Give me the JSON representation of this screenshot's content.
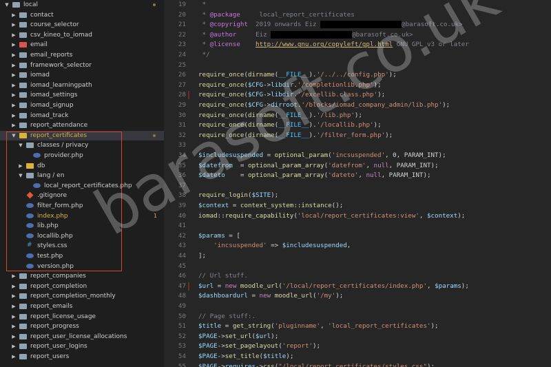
{
  "sidebar": {
    "items": [
      {
        "label": "local",
        "depth": 0,
        "kind": "folder",
        "open": true,
        "mod": "dot"
      },
      {
        "label": "contact",
        "depth": 1,
        "kind": "folder",
        "open": false
      },
      {
        "label": "course_selector",
        "depth": 1,
        "kind": "folder",
        "open": false
      },
      {
        "label": "csv_kineo_to_iomad",
        "depth": 1,
        "kind": "folder",
        "open": false
      },
      {
        "label": "email",
        "depth": 1,
        "kind": "folder",
        "open": false,
        "color": "red"
      },
      {
        "label": "email_reports",
        "depth": 1,
        "kind": "folder",
        "open": false
      },
      {
        "label": "framework_selector",
        "depth": 1,
        "kind": "folder",
        "open": false
      },
      {
        "label": "iomad",
        "depth": 1,
        "kind": "folder",
        "open": false
      },
      {
        "label": "iomad_learningpath",
        "depth": 1,
        "kind": "folder",
        "open": false
      },
      {
        "label": "iomad_settings",
        "depth": 1,
        "kind": "folder",
        "open": false
      },
      {
        "label": "iomad_signup",
        "depth": 1,
        "kind": "folder",
        "open": false
      },
      {
        "label": "iomad_track",
        "depth": 1,
        "kind": "folder",
        "open": false
      },
      {
        "label": "report_attendance",
        "depth": 1,
        "kind": "folder",
        "open": false
      },
      {
        "label": "report_certificates",
        "depth": 1,
        "kind": "folder",
        "open": true,
        "mod": "dot",
        "color": "yellow",
        "label_color": "#d7b44a"
      },
      {
        "label": "classes / privacy",
        "depth": 2,
        "kind": "folder",
        "open": true
      },
      {
        "label": "provider.php",
        "depth": 3,
        "kind": "php"
      },
      {
        "label": "db",
        "depth": 2,
        "kind": "folder",
        "open": false,
        "color": "yellow"
      },
      {
        "label": "lang / en",
        "depth": 2,
        "kind": "folder",
        "open": true
      },
      {
        "label": "local_report_certificates.php",
        "depth": 3,
        "kind": "php"
      },
      {
        "label": ".gitignore",
        "depth": 2,
        "kind": "git"
      },
      {
        "label": "filter_form.php",
        "depth": 2,
        "kind": "php"
      },
      {
        "label": "index.php",
        "depth": 2,
        "kind": "php",
        "mod": "1",
        "label_color": "#d7b44a"
      },
      {
        "label": "lib.php",
        "depth": 2,
        "kind": "php"
      },
      {
        "label": "locallib.php",
        "depth": 2,
        "kind": "php"
      },
      {
        "label": "styles.css",
        "depth": 2,
        "kind": "css"
      },
      {
        "label": "test.php",
        "depth": 2,
        "kind": "php"
      },
      {
        "label": "version.php",
        "depth": 2,
        "kind": "php"
      },
      {
        "label": "report_companies",
        "depth": 1,
        "kind": "folder",
        "open": false
      },
      {
        "label": "report_completion",
        "depth": 1,
        "kind": "folder",
        "open": false
      },
      {
        "label": "report_completion_monthly",
        "depth": 1,
        "kind": "folder",
        "open": false
      },
      {
        "label": "report_emails",
        "depth": 1,
        "kind": "folder",
        "open": false
      },
      {
        "label": "report_license_usage",
        "depth": 1,
        "kind": "folder",
        "open": false
      },
      {
        "label": "report_progress",
        "depth": 1,
        "kind": "folder",
        "open": false
      },
      {
        "label": "report_user_license_allocations",
        "depth": 1,
        "kind": "folder",
        "open": false
      },
      {
        "label": "report_user_logins",
        "depth": 1,
        "kind": "folder",
        "open": false
      },
      {
        "label": "report_users",
        "depth": 1,
        "kind": "folder",
        "open": false
      }
    ]
  },
  "editor": {
    "lines": [
      {
        "n": "19",
        "parts": [
          [
            " *",
            "cm"
          ]
        ]
      },
      {
        "n": "20",
        "parts": [
          [
            " * ",
            "cm"
          ],
          [
            "@package",
            "tag"
          ],
          [
            "     local_report_certificates",
            "cm"
          ]
        ]
      },
      {
        "n": "21",
        "parts": [
          [
            " * ",
            "cm"
          ],
          [
            "@copyright",
            "tag"
          ],
          [
            "  2019 onwards Eiz ",
            "cm"
          ],
          [
            "",
            "redact:118"
          ],
          [
            "@barasoft.co.uk>",
            "cm"
          ]
        ]
      },
      {
        "n": "22",
        "parts": [
          [
            " * ",
            "cm"
          ],
          [
            "@author",
            "tag"
          ],
          [
            "     Eiz ",
            "cm"
          ],
          [
            "",
            "redact:118"
          ],
          [
            "@barasoft.co.uk>",
            "cm"
          ]
        ]
      },
      {
        "n": "23",
        "parts": [
          [
            " * ",
            "cm"
          ],
          [
            "@license",
            "tag"
          ],
          [
            "    ",
            "cm"
          ],
          [
            "http://www.gnu.org/copyleft/gpl.html",
            "url"
          ],
          [
            " GNU GPL v3 or later",
            "cm"
          ]
        ]
      },
      {
        "n": "24",
        "parts": [
          [
            " */",
            "cm"
          ]
        ]
      },
      {
        "n": "25",
        "parts": []
      },
      {
        "n": "26",
        "parts": [
          [
            "require_once",
            "fn"
          ],
          [
            "(",
            "p"
          ],
          [
            "dirname",
            "fn"
          ],
          [
            "(",
            "p"
          ],
          [
            "__FILE__",
            "const"
          ],
          [
            ").",
            "p"
          ],
          [
            "'/../../config.php'",
            "str"
          ],
          [
            ");",
            "p"
          ]
        ]
      },
      {
        "n": "27",
        "parts": [
          [
            "require_once",
            "fn"
          ],
          [
            "(",
            "p"
          ],
          [
            "$CFG",
            "var"
          ],
          [
            "->",
            "p"
          ],
          [
            "libdir",
            "var"
          ],
          [
            ".",
            "p"
          ],
          [
            "'/completionlib.php'",
            "str"
          ],
          [
            ");",
            "p"
          ]
        ]
      },
      {
        "n": "28",
        "parts": [
          [
            "require_once",
            "fn"
          ],
          [
            "(",
            "p"
          ],
          [
            "$CFG",
            "var"
          ],
          [
            "->",
            "p"
          ],
          [
            "libdir",
            "var"
          ],
          [
            ".",
            "p"
          ],
          [
            "'/excellib.class.php'",
            "str"
          ],
          [
            ");",
            "p"
          ]
        ]
      },
      {
        "n": "29",
        "parts": [
          [
            "require_once",
            "fn"
          ],
          [
            "(",
            "p"
          ],
          [
            "$CFG",
            "var"
          ],
          [
            "->",
            "p"
          ],
          [
            "dirroot",
            "var"
          ],
          [
            ".",
            "p"
          ],
          [
            "'/blocks/iomad_company_admin/lib.php'",
            "str"
          ],
          [
            ");",
            "p"
          ]
        ]
      },
      {
        "n": "30",
        "parts": [
          [
            "require_once",
            "fn"
          ],
          [
            "(",
            "p"
          ],
          [
            "dirname",
            "fn"
          ],
          [
            "(",
            "p"
          ],
          [
            "__FILE__",
            "const"
          ],
          [
            ").",
            "p"
          ],
          [
            "'/lib.php'",
            "str"
          ],
          [
            ");",
            "p"
          ]
        ]
      },
      {
        "n": "31",
        "parts": [
          [
            "require_once",
            "fn"
          ],
          [
            "(",
            "p"
          ],
          [
            "dirname",
            "fn"
          ],
          [
            "(",
            "p"
          ],
          [
            "__FILE__",
            "const"
          ],
          [
            ").",
            "p"
          ],
          [
            "'/locallib.php'",
            "str"
          ],
          [
            ");",
            "p"
          ]
        ]
      },
      {
        "n": "32",
        "parts": [
          [
            "require_once",
            "fn"
          ],
          [
            "(",
            "p"
          ],
          [
            "dirname",
            "fn"
          ],
          [
            "(",
            "p"
          ],
          [
            "__FILE__",
            "const"
          ],
          [
            ").",
            "p"
          ],
          [
            "'/filter_form.php'",
            "str"
          ],
          [
            ");",
            "p"
          ]
        ]
      },
      {
        "n": "33",
        "parts": []
      },
      {
        "n": "34",
        "parts": [
          [
            "$includesuspended",
            "var"
          ],
          [
            " = ",
            "p"
          ],
          [
            "optional_param",
            "fn"
          ],
          [
            "(",
            "p"
          ],
          [
            "'incsuspended'",
            "str"
          ],
          [
            ", 0, PARAM_INT);",
            "p"
          ]
        ]
      },
      {
        "n": "35",
        "parts": [
          [
            "$datefrom",
            "var"
          ],
          [
            "  = ",
            "p"
          ],
          [
            "optional_param_array",
            "fn"
          ],
          [
            "(",
            "p"
          ],
          [
            "'datefrom'",
            "str"
          ],
          [
            ", ",
            "p"
          ],
          [
            "null",
            "kw"
          ],
          [
            ", PARAM_INT);",
            "p"
          ]
        ]
      },
      {
        "n": "36",
        "parts": [
          [
            "$dateto",
            "var"
          ],
          [
            "    = ",
            "p"
          ],
          [
            "optional_param_array",
            "fn"
          ],
          [
            "(",
            "p"
          ],
          [
            "'dateto'",
            "str"
          ],
          [
            ", ",
            "p"
          ],
          [
            "null",
            "kw"
          ],
          [
            ", PARAM_INT);",
            "p"
          ]
        ]
      },
      {
        "n": "37",
        "parts": []
      },
      {
        "n": "38",
        "parts": [
          [
            "require_login",
            "fn"
          ],
          [
            "(",
            "p"
          ],
          [
            "$SITE",
            "var"
          ],
          [
            ");",
            "p"
          ]
        ]
      },
      {
        "n": "39",
        "parts": [
          [
            "$context",
            "var"
          ],
          [
            " = ",
            "p"
          ],
          [
            "context_system",
            "fn"
          ],
          [
            "::",
            "p"
          ],
          [
            "instance",
            "fn"
          ],
          [
            "();",
            "p"
          ]
        ]
      },
      {
        "n": "40",
        "parts": [
          [
            "iomad",
            "fn"
          ],
          [
            "::",
            "p"
          ],
          [
            "require_capability",
            "fn"
          ],
          [
            "(",
            "p"
          ],
          [
            "'local/report_certificates:view'",
            "str"
          ],
          [
            ", ",
            "p"
          ],
          [
            "$context",
            "var"
          ],
          [
            ");",
            "p"
          ]
        ]
      },
      {
        "n": "41",
        "parts": []
      },
      {
        "n": "42",
        "parts": [
          [
            "$params",
            "var"
          ],
          [
            " = [",
            "p"
          ]
        ]
      },
      {
        "n": "43",
        "parts": [
          [
            "    ",
            "p"
          ],
          [
            "'incsuspended'",
            "str"
          ],
          [
            " => ",
            "p"
          ],
          [
            "$includesuspended",
            "var"
          ],
          [
            ",",
            "p"
          ]
        ]
      },
      {
        "n": "44",
        "parts": [
          [
            "];",
            "p"
          ]
        ]
      },
      {
        "n": "45",
        "parts": []
      },
      {
        "n": "46",
        "parts": [
          [
            "// Url stuff.",
            "cm"
          ]
        ]
      },
      {
        "n": "47",
        "parts": [
          [
            "$url",
            "var"
          ],
          [
            " = ",
            "p"
          ],
          [
            "new",
            "kw"
          ],
          [
            " ",
            "p"
          ],
          [
            "moodle_url",
            "fn"
          ],
          [
            "(",
            "p"
          ],
          [
            "'/local/report_certificates/index.php'",
            "str"
          ],
          [
            ", ",
            "p"
          ],
          [
            "$params",
            "var"
          ],
          [
            ");",
            "p"
          ]
        ]
      },
      {
        "n": "48",
        "parts": [
          [
            "$dashboardurl",
            "var"
          ],
          [
            " = ",
            "p"
          ],
          [
            "new",
            "kw"
          ],
          [
            " ",
            "p"
          ],
          [
            "moodle_url",
            "fn"
          ],
          [
            "(",
            "p"
          ],
          [
            "'/my'",
            "str"
          ],
          [
            ");",
            "p"
          ]
        ]
      },
      {
        "n": "49",
        "parts": []
      },
      {
        "n": "50",
        "parts": [
          [
            "// Page stuff:.",
            "cm"
          ]
        ]
      },
      {
        "n": "51",
        "parts": [
          [
            "$title",
            "var"
          ],
          [
            " = ",
            "p"
          ],
          [
            "get_string",
            "fn"
          ],
          [
            "(",
            "p"
          ],
          [
            "'pluginname'",
            "str"
          ],
          [
            ", ",
            "p"
          ],
          [
            "'local_report_certificates'",
            "str"
          ],
          [
            ");",
            "p"
          ]
        ]
      },
      {
        "n": "52",
        "parts": [
          [
            "$PAGE",
            "var"
          ],
          [
            "->",
            "p"
          ],
          [
            "set_url",
            "fn"
          ],
          [
            "(",
            "p"
          ],
          [
            "$url",
            "var"
          ],
          [
            ");",
            "p"
          ]
        ]
      },
      {
        "n": "53",
        "parts": [
          [
            "$PAGE",
            "var"
          ],
          [
            "->",
            "p"
          ],
          [
            "set_pagelayout",
            "fn"
          ],
          [
            "(",
            "p"
          ],
          [
            "'report'",
            "str"
          ],
          [
            ");",
            "p"
          ]
        ]
      },
      {
        "n": "54",
        "parts": [
          [
            "$PAGE",
            "var"
          ],
          [
            "->",
            "p"
          ],
          [
            "set_title",
            "fn"
          ],
          [
            "(",
            "p"
          ],
          [
            "$title",
            "var"
          ],
          [
            ");",
            "p"
          ]
        ]
      },
      {
        "n": "55",
        "parts": [
          [
            "$PAGE",
            "var"
          ],
          [
            "->",
            "p"
          ],
          [
            "requires",
            "var"
          ],
          [
            "->",
            "p"
          ],
          [
            "css",
            "fn"
          ],
          [
            "(",
            "p"
          ],
          [
            "\"/local/report_certificates/styles.css\"",
            "str"
          ],
          [
            ");",
            "p"
          ]
        ]
      }
    ]
  },
  "watermark": {
    "text": "barasoft.co.uk"
  },
  "colors": {
    "selection_border": "#d0482f",
    "modified": "#d7b44a",
    "sidebar_bg": "#1e1e1e",
    "editor_bg": "#262626"
  }
}
